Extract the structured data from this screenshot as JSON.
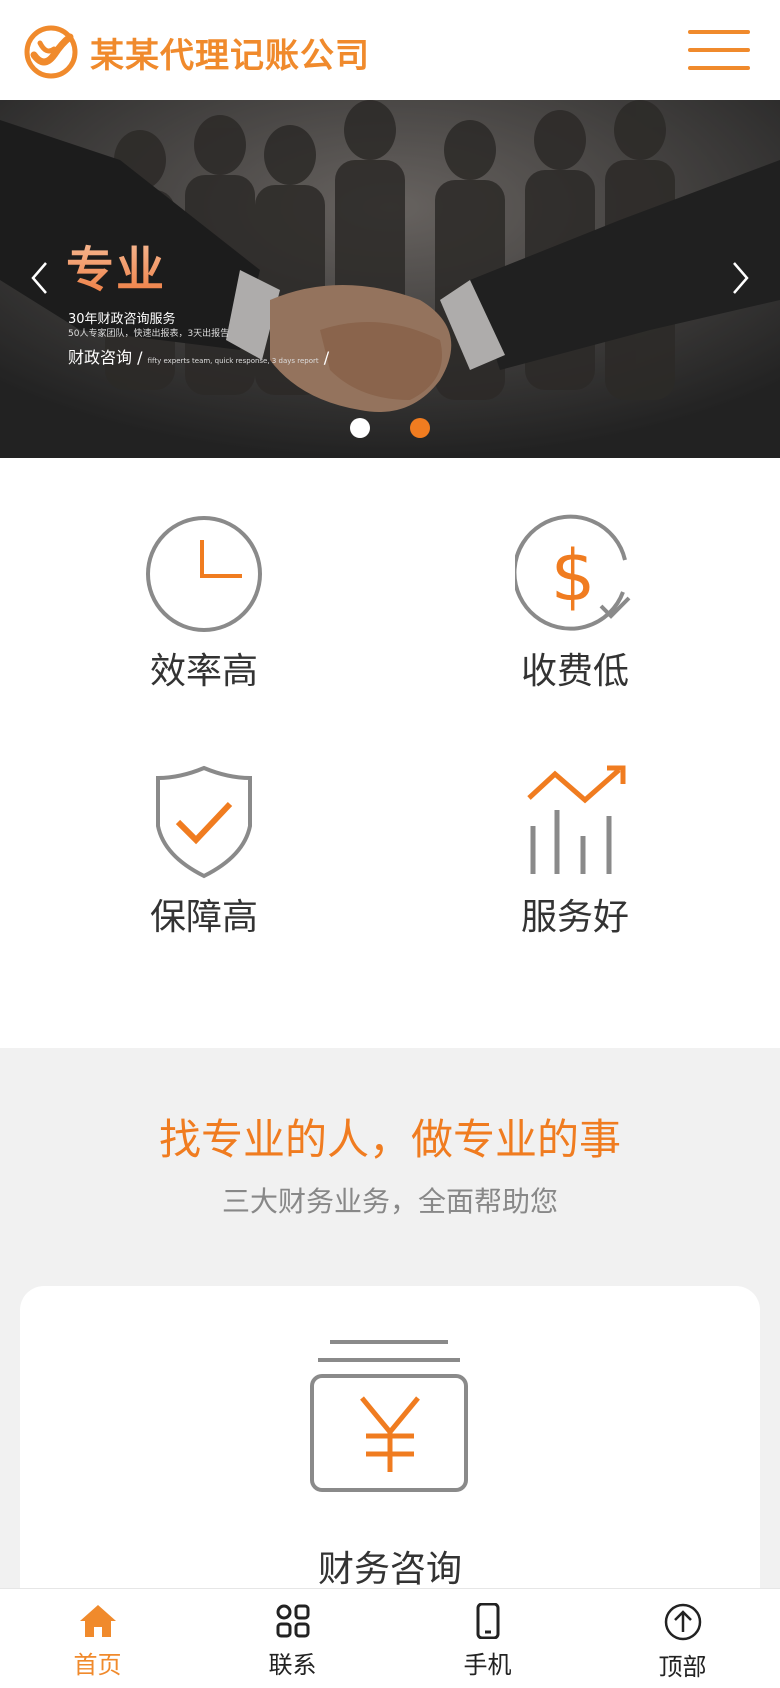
{
  "header": {
    "company_name": "某某代理记账公司",
    "logo_icon": "company-logo-icon",
    "menu_icon": "hamburger-menu-icon"
  },
  "banner": {
    "title": "专业",
    "subtitle": "30年财政咨询服务",
    "subtitle_small": "50人专家团队，快速出报表，3天出报告",
    "line_label": "财政咨询",
    "line_small": "fifty experts team, quick response, 3 days report",
    "prev_icon": "chevron-left-icon",
    "next_icon": "chevron-right-icon",
    "active_slide": 2,
    "slide_count": 2
  },
  "features": [
    {
      "label": "效率高",
      "icon": "clock-icon"
    },
    {
      "label": "收费低",
      "icon": "dollar-check-icon"
    },
    {
      "label": "保障高",
      "icon": "shield-check-icon"
    },
    {
      "label": "服务好",
      "icon": "growth-chart-icon"
    }
  ],
  "services": {
    "title": "找专业的人，做专业的事",
    "subtitle": "三大财务业务，全面帮助您",
    "card": {
      "label": "财务咨询",
      "icon": "yen-stack-icon"
    }
  },
  "bottom_nav": [
    {
      "label": "首页",
      "icon": "home-icon",
      "active": true
    },
    {
      "label": "联系",
      "icon": "grid-icon",
      "active": false
    },
    {
      "label": "手机",
      "icon": "phone-icon",
      "active": false
    },
    {
      "label": "顶部",
      "icon": "arrow-up-circle-icon",
      "active": false
    }
  ],
  "colors": {
    "accent": "#f07c20",
    "text": "#333333",
    "section_bg": "#f1f1f1"
  }
}
